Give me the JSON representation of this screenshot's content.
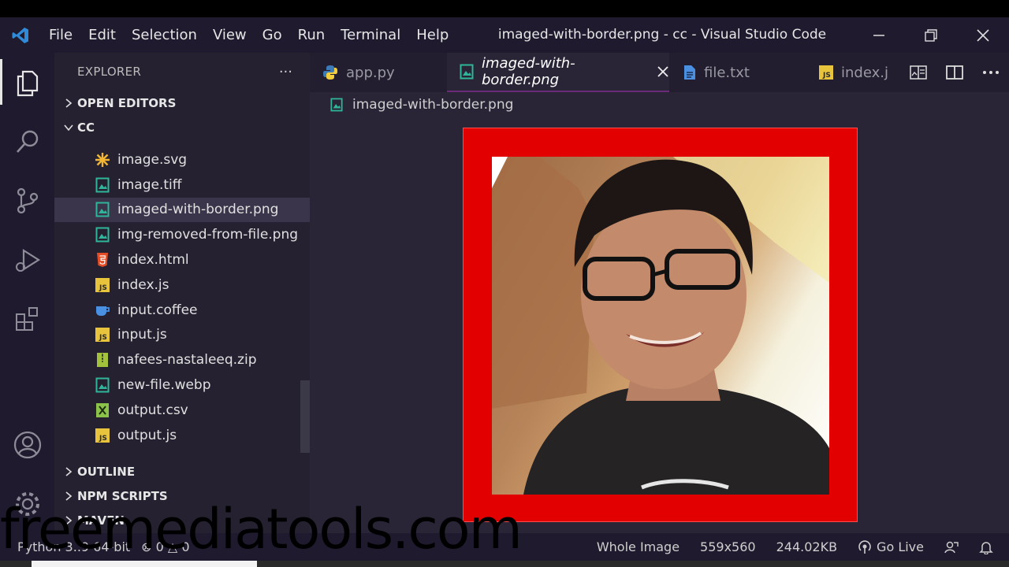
{
  "titlebar": {
    "menu": [
      "File",
      "Edit",
      "Selection",
      "View",
      "Go",
      "Run",
      "Terminal",
      "Help"
    ],
    "window_title": "imaged-with-border.png - cc - Visual Studio Code"
  },
  "sidebar": {
    "title": "EXPLORER",
    "more": "···",
    "open_editors": "OPEN EDITORS",
    "folder": "CC",
    "files": [
      {
        "name": "image.svg",
        "icon": "svg-icon"
      },
      {
        "name": "image.tiff",
        "icon": "image-file-icon"
      },
      {
        "name": "imaged-with-border.png",
        "icon": "image-file-icon",
        "selected": true
      },
      {
        "name": "img-removed-from-file.png",
        "icon": "image-file-icon"
      },
      {
        "name": "index.html",
        "icon": "html-file-icon"
      },
      {
        "name": "index.js",
        "icon": "js-file-icon"
      },
      {
        "name": "input.coffee",
        "icon": "coffee-file-icon"
      },
      {
        "name": "input.js",
        "icon": "js-file-icon"
      },
      {
        "name": "nafees-nastaleeq.zip",
        "icon": "zip-file-icon"
      },
      {
        "name": "new-file.webp",
        "icon": "image-file-icon"
      },
      {
        "name": "output.csv",
        "icon": "csv-file-icon"
      },
      {
        "name": "output.js",
        "icon": "js-file-icon"
      }
    ],
    "sections": [
      "OUTLINE",
      "NPM SCRIPTS",
      "MAVEN"
    ]
  },
  "tabs": [
    {
      "label": "app.py",
      "icon": "python-icon"
    },
    {
      "label": "imaged-with-border.png",
      "icon": "image-file-icon",
      "active": true
    },
    {
      "label": "file.txt",
      "icon": "text-file-icon"
    },
    {
      "label": "index.j",
      "icon": "js-file-icon"
    }
  ],
  "breadcrumb": "imaged-with-border.png",
  "status": {
    "left": [
      "Python 3.",
      ".9 64-bit",
      "⊗ 0 △ 0"
    ],
    "zoom": "Whole Image",
    "dimensions": "559x560",
    "size": "244.02KB",
    "go_live": "Go Live"
  },
  "watermark": "freemediatools.com",
  "colors": {
    "accent_border": "#e30000",
    "background": "#292537"
  }
}
